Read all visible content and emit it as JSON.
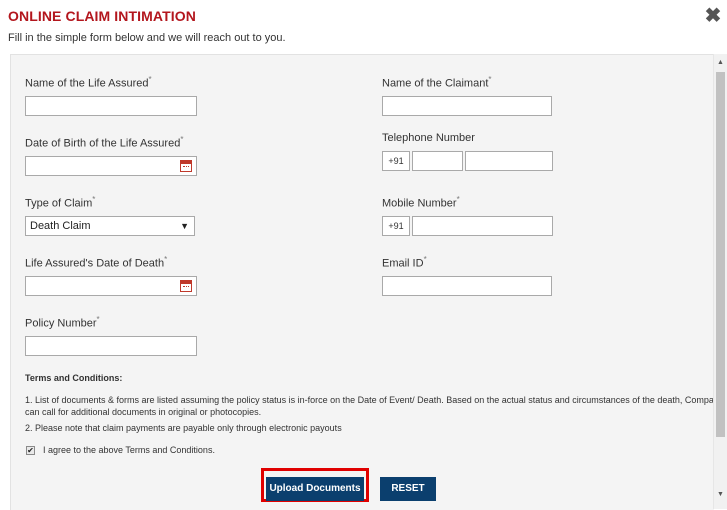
{
  "header": {
    "title": "ONLINE CLAIM INTIMATION",
    "subtitle": "Fill in the simple form below and we will reach out to you.",
    "close_symbol": "✖",
    "close_icon": "close-icon"
  },
  "form": {
    "required_mark": "*",
    "life_assured_name": {
      "label": "Name of the Life Assured",
      "value": ""
    },
    "claimant_name": {
      "label": "Name of the Claimant",
      "value": ""
    },
    "dob": {
      "label": "Date of Birth of the Life Assured",
      "value": "",
      "icon": "calendar-icon"
    },
    "telephone": {
      "label": "Telephone Number",
      "prefix": "+91",
      "std_code": "",
      "number": ""
    },
    "claim_type": {
      "label": "Type of Claim",
      "selected": "Death Claim",
      "arrow": "▼"
    },
    "mobile": {
      "label": "Mobile Number",
      "prefix": "+91",
      "value": ""
    },
    "date_of_death": {
      "label": "Life Assured's Date of Death",
      "value": "",
      "icon": "calendar-icon"
    },
    "email": {
      "label": "Email ID",
      "value": ""
    },
    "policy_number": {
      "label": "Policy Number",
      "value": ""
    }
  },
  "terms": {
    "heading": "Terms and Conditions:",
    "line1": "1. List of documents & forms are listed assuming the policy status is in-force on the Date of Event/ Death. Based on the actual status and circumstances of the death, Compa",
    "line2": "can call for additional documents in original or photocopies.",
    "line3": "2. Please note that claim payments are payable only through electronic payouts",
    "agree_checked": true,
    "check_mark": "✔",
    "agree_label": "I agree to the above Terms and Conditions."
  },
  "buttons": {
    "upload": "Upload Documents",
    "reset": "RESET"
  },
  "scrollbar": {
    "up": "▲",
    "down": "▼"
  },
  "colors": {
    "title_red": "#b3161d",
    "button_blue": "#0b3f6e",
    "highlight_red": "#e00000",
    "panel_bg": "#f4f4f4"
  }
}
